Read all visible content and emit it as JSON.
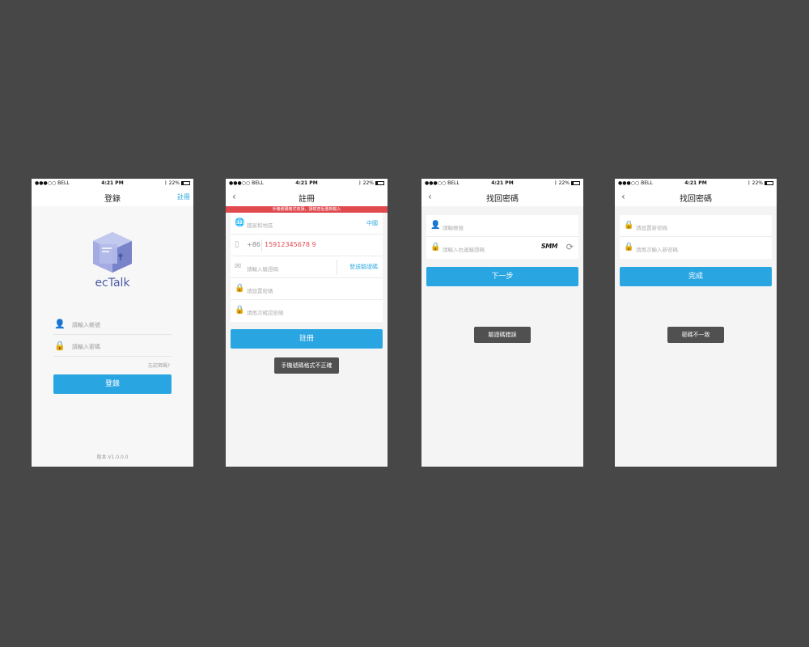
{
  "status_bar": {
    "carrier": "●●●○○ BELL",
    "time": "4:21 PM",
    "battery": "22%"
  },
  "screens": {
    "login": {
      "title": "登錄",
      "register_link": "註冊",
      "brand": "ecTalk",
      "username_placeholder": "請輸入帳號",
      "password_placeholder": "請輸入密碼",
      "forgot_password": "忘記密碼?",
      "login_button": "登錄",
      "version": "版本 V1.0.0.0"
    },
    "register": {
      "title": "註冊",
      "error_banner": "手機號碼格式有誤，請檢查后重新輸入",
      "region_placeholder": "國家和地區",
      "region_value": "中國",
      "phone_prefix": "+86",
      "phone_value": "15912345678 9",
      "code_placeholder": "請輸入驗證碼",
      "send_code": "發送驗證碼",
      "password_placeholder": "請設置密碼",
      "confirm_placeholder": "請再次確認密碼",
      "register_button": "註冊",
      "toast": "手機號碼格式不正確"
    },
    "recover": {
      "title": "找回密碼",
      "account_placeholder": "請輸帳號",
      "captcha_placeholder": "請輸入右邊驗證碼",
      "captcha_text": "SMM",
      "next_button": "下一步",
      "toast": "驗證碼錯誤"
    },
    "reset": {
      "title": "找回密碼",
      "new_password_placeholder": "請設置新密碼",
      "confirm_placeholder": "請再次輸入新密碼",
      "done_button": "完成",
      "toast": "密碼不一致"
    }
  },
  "colors": {
    "accent": "#29a6e2",
    "error": "#e04a4f",
    "toast": "#505050",
    "background": "#474747"
  }
}
